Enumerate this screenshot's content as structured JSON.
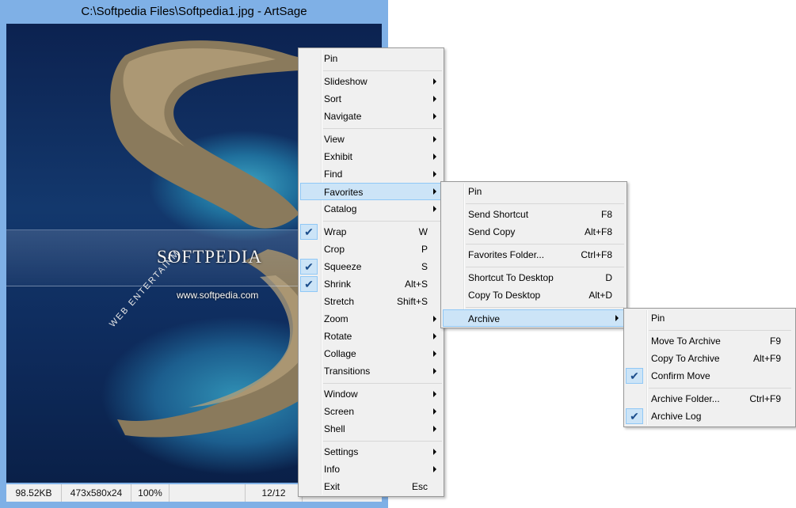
{
  "window": {
    "title": "C:\\Softpedia Files\\Softpedia1.jpg - ArtSage"
  },
  "image": {
    "watermark_logo": "SOFTPEDIA",
    "watermark_url": "www.softpedia.com",
    "watermark_arc": "WEB  ENTERTAINM"
  },
  "status_bar": {
    "file_size": "98.52KB",
    "dimensions": "473x580x24",
    "zoom": "100%",
    "blank": "",
    "index": "12/12"
  },
  "main_menu": {
    "items": [
      {
        "label": "Pin"
      },
      {
        "label": "Slideshow",
        "submenu": true
      },
      {
        "label": "Sort",
        "submenu": true
      },
      {
        "label": "Navigate",
        "submenu": true
      },
      {
        "label": "View",
        "submenu": true
      },
      {
        "label": "Exhibit",
        "submenu": true
      },
      {
        "label": "Find",
        "submenu": true
      },
      {
        "label": "Favorites",
        "submenu": true,
        "highlighted": true
      },
      {
        "label": "Catalog",
        "submenu": true
      },
      {
        "label": "Wrap",
        "shortcut": "W",
        "checked": true
      },
      {
        "label": "Crop",
        "shortcut": "P"
      },
      {
        "label": "Squeeze",
        "shortcut": "S",
        "checked": true
      },
      {
        "label": "Shrink",
        "shortcut": "Alt+S",
        "checked": true
      },
      {
        "label": "Stretch",
        "shortcut": "Shift+S"
      },
      {
        "label": "Zoom",
        "submenu": true
      },
      {
        "label": "Rotate",
        "submenu": true
      },
      {
        "label": "Collage",
        "submenu": true
      },
      {
        "label": "Transitions",
        "submenu": true
      },
      {
        "label": "Window",
        "submenu": true
      },
      {
        "label": "Screen",
        "submenu": true
      },
      {
        "label": "Shell",
        "submenu": true
      },
      {
        "label": "Settings",
        "submenu": true
      },
      {
        "label": "Info",
        "submenu": true
      },
      {
        "label": "Exit",
        "shortcut": "Esc"
      }
    ]
  },
  "favorites_menu": {
    "items": [
      {
        "label": "Pin"
      },
      {
        "label": "Send Shortcut",
        "shortcut": "F8"
      },
      {
        "label": "Send Copy",
        "shortcut": "Alt+F8"
      },
      {
        "label": "Favorites Folder...",
        "shortcut": "Ctrl+F8"
      },
      {
        "label": "Shortcut To Desktop",
        "shortcut": "D"
      },
      {
        "label": "Copy To Desktop",
        "shortcut": "Alt+D"
      },
      {
        "label": "Archive",
        "submenu": true,
        "highlighted": true
      }
    ]
  },
  "archive_menu": {
    "items": [
      {
        "label": "Pin"
      },
      {
        "label": "Move To Archive",
        "shortcut": "F9"
      },
      {
        "label": "Copy To Archive",
        "shortcut": "Alt+F9"
      },
      {
        "label": "Confirm Move",
        "checked": true
      },
      {
        "label": "Archive Folder...",
        "shortcut": "Ctrl+F9"
      },
      {
        "label": "Archive Log",
        "checked": true
      }
    ]
  },
  "colors": {
    "window_frame": "#7fb0e6",
    "menu_bg": "#f0f0f0",
    "highlight_bg": "#cce4f7",
    "highlight_border": "#90c8f6"
  }
}
